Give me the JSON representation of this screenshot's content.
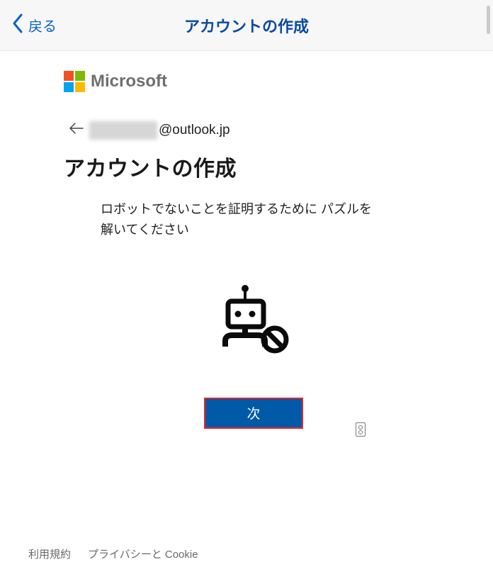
{
  "header": {
    "back_label": "戻る",
    "title": "アカウントの作成"
  },
  "brand": {
    "name": "Microsoft"
  },
  "email": {
    "domain_part": "@outlook.jp"
  },
  "main": {
    "heading": "アカウントの作成",
    "instruction": "ロボットでないことを証明するために パズルを解いてください",
    "next_label": "次"
  },
  "footer": {
    "terms": "利用規約",
    "privacy": "プライバシーと Cookie"
  }
}
